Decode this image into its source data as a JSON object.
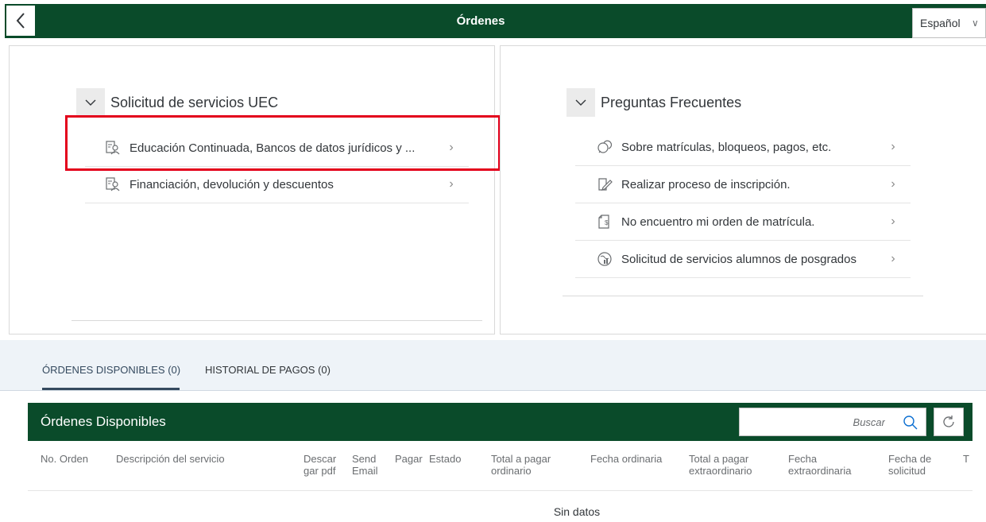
{
  "header": {
    "title": "Órdenes",
    "language": "Español"
  },
  "left_panel": {
    "group_title": "Solicitud de servicios UEC",
    "items": [
      {
        "label": "Educación Continuada, Bancos de datos jurídicos y ...",
        "icon": "document-person-icon"
      },
      {
        "label": "Financiación, devolución y descuentos",
        "icon": "document-person-icon"
      }
    ]
  },
  "right_panel": {
    "group_title": "Preguntas Frecuentes",
    "items": [
      {
        "label": "Sobre matrículas, bloqueos, pagos, etc.",
        "icon": "discussion-icon"
      },
      {
        "label": "Realizar proceso de inscripción.",
        "icon": "edit-document-icon"
      },
      {
        "label": "No encuentro mi orden de matrícula.",
        "icon": "money-document-icon"
      },
      {
        "label": "Solicitud de servicios alumnos de posgrados",
        "icon": "globe-chart-icon"
      }
    ]
  },
  "tabs": [
    {
      "label": "ÓRDENES DISPONIBLES (0)",
      "active": true
    },
    {
      "label": "HISTORIAL DE PAGOS (0)",
      "active": false
    }
  ],
  "table": {
    "title": "Órdenes Disponibles",
    "search_placeholder": "Buscar",
    "columns": [
      "No. Orden",
      "Descripción del servicio",
      "Descar gar pdf",
      "Send Email",
      "Pagar",
      "Estado",
      "Total a pagar ordinario",
      "Fecha ordinaria",
      "Total a pagar extraordinario",
      "Fecha extraordinaria",
      "Fecha de solicitud",
      "T"
    ],
    "column_lines": [
      [
        "No. Orden"
      ],
      [
        "Descripción del servicio"
      ],
      [
        "Descar",
        "gar pdf"
      ],
      [
        "Send",
        "Email"
      ],
      [
        "Pagar"
      ],
      [
        "Estado"
      ],
      [
        "Total a pagar",
        "ordinario"
      ],
      [
        "Fecha ordinaria"
      ],
      [
        "Total a pagar",
        "extraordinario"
      ],
      [
        "Fecha",
        "extraordinaria"
      ],
      [
        "Fecha de",
        "solicitud"
      ],
      [
        "T"
      ]
    ],
    "empty_text": "Sin datos"
  },
  "colors": {
    "brand_green": "#0a4b2a",
    "highlight_red": "#e3001b",
    "tab_active": "#354a5f"
  }
}
